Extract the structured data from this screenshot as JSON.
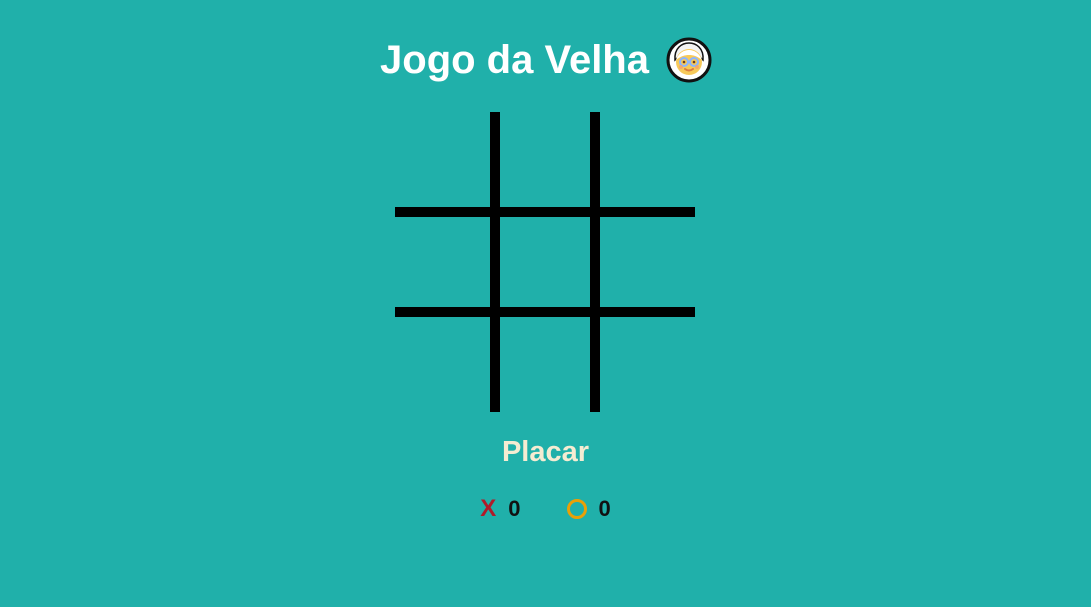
{
  "game": {
    "title": "Jogo da Velha",
    "title_icon": "grandma-icon",
    "board": [
      [
        "",
        "",
        ""
      ],
      [
        "",
        "",
        ""
      ],
      [
        "",
        "",
        ""
      ]
    ],
    "colors": {
      "background": "#20b0aa",
      "title": "#ffffff",
      "scoreboard_title": "#f5ecd2",
      "board_lines": "#000000",
      "x_player": "#b01b2a",
      "o_player": "#eaa006"
    }
  },
  "scoreboard": {
    "title": "Placar",
    "players": [
      {
        "mark": "X",
        "score": "0"
      },
      {
        "mark": "O",
        "score": "0"
      }
    ]
  }
}
